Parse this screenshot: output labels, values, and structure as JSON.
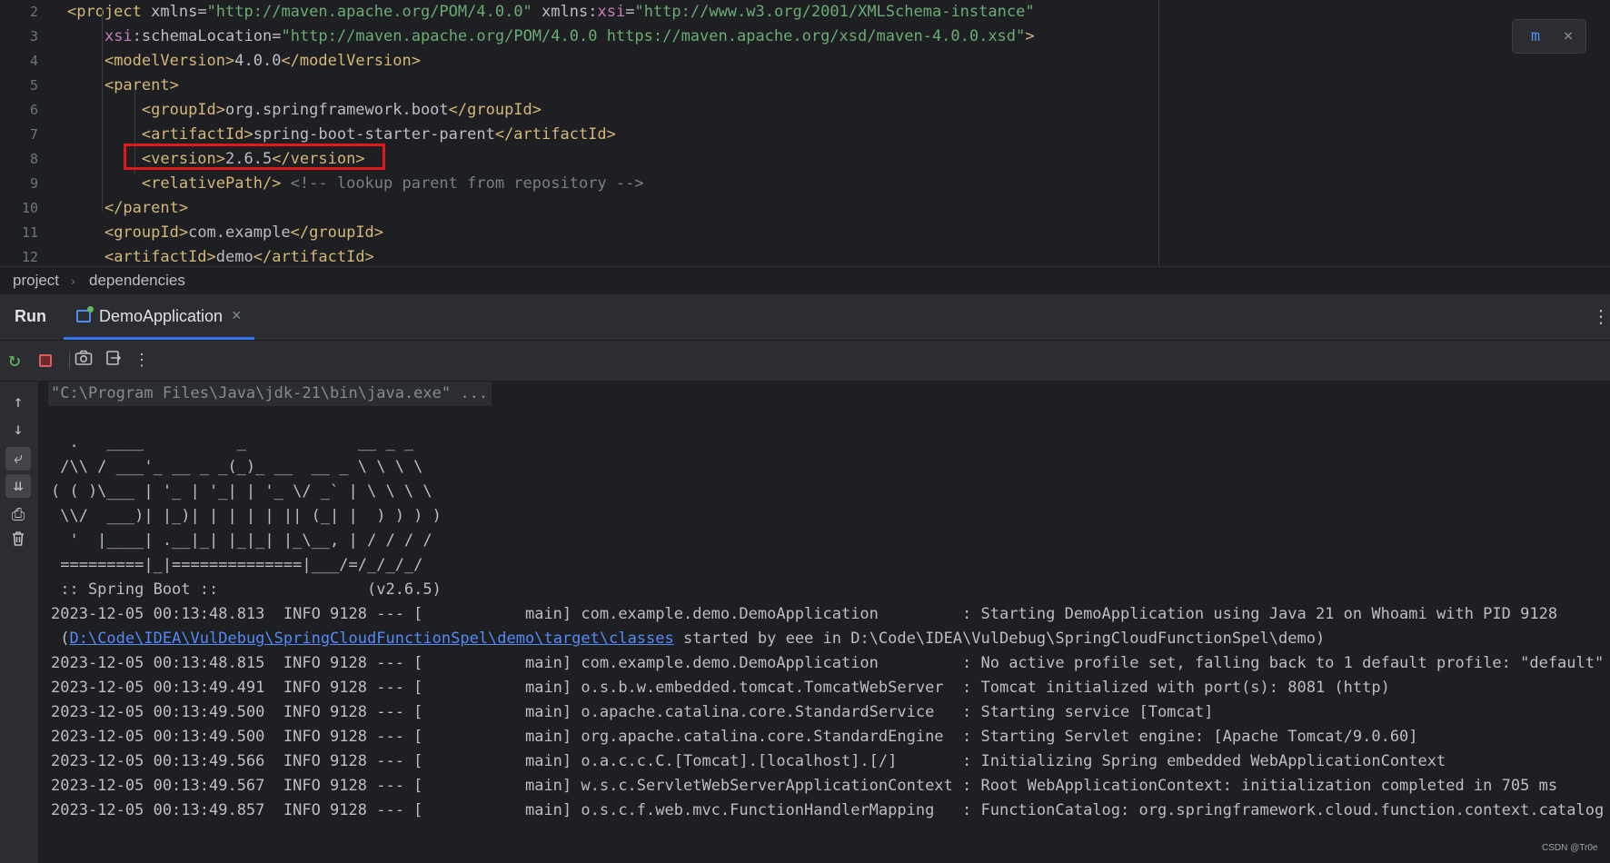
{
  "editor": {
    "line_numbers": [
      "2",
      "3",
      "4",
      "5",
      "6",
      "7",
      "8",
      "9",
      "10",
      "11",
      "12"
    ],
    "lines": [
      {
        "indent": "",
        "parts": [
          [
            "tag",
            "<project "
          ],
          [
            "attr",
            "xmlns"
          ],
          [
            "txt",
            "="
          ],
          [
            "str",
            "\"http://maven.apache.org/POM/4.0.0\""
          ],
          [
            "txt",
            " "
          ],
          [
            "attr",
            "xmlns"
          ],
          [
            "txt",
            ":"
          ],
          [
            "ns",
            "xsi"
          ],
          [
            "txt",
            "="
          ],
          [
            "str",
            "\"http://www.w3.org/2001/XMLSchema-instance\""
          ]
        ]
      },
      {
        "indent": "    ",
        "parts": [
          [
            "ns",
            "xsi"
          ],
          [
            "txt",
            ":"
          ],
          [
            "attr",
            "schemaLocation"
          ],
          [
            "txt",
            "="
          ],
          [
            "str",
            "\"http://maven.apache.org/POM/4.0.0 https://maven.apache.org/xsd/maven-4.0.0.xsd\""
          ],
          [
            "tag",
            ">"
          ]
        ]
      },
      {
        "indent": "    ",
        "parts": [
          [
            "tag",
            "<modelVersion>"
          ],
          [
            "txt",
            "4.0.0"
          ],
          [
            "tag",
            "</modelVersion>"
          ]
        ]
      },
      {
        "indent": "    ",
        "parts": [
          [
            "tag",
            "<parent>"
          ]
        ]
      },
      {
        "indent": "        ",
        "parts": [
          [
            "tag",
            "<groupId>"
          ],
          [
            "txt",
            "org.springframework.boot"
          ],
          [
            "tag",
            "</groupId>"
          ]
        ]
      },
      {
        "indent": "        ",
        "parts": [
          [
            "tag",
            "<artifactId>"
          ],
          [
            "txt",
            "spring-boot-starter-parent"
          ],
          [
            "tag",
            "</artifactId>"
          ]
        ]
      },
      {
        "indent": "        ",
        "parts": [
          [
            "tag",
            "<version>"
          ],
          [
            "txt",
            "2.6.5"
          ],
          [
            "tag",
            "</version>"
          ]
        ]
      },
      {
        "indent": "        ",
        "parts": [
          [
            "tag",
            "<relativePath/>"
          ],
          [
            "txt",
            " "
          ],
          [
            "cmt",
            "<!-- lookup parent from repository -->"
          ]
        ]
      },
      {
        "indent": "    ",
        "parts": [
          [
            "tag",
            "</parent>"
          ]
        ]
      },
      {
        "indent": "    ",
        "parts": [
          [
            "tag",
            "<groupId>"
          ],
          [
            "txt",
            "com.example"
          ],
          [
            "tag",
            "</groupId>"
          ]
        ]
      },
      {
        "indent": "    ",
        "parts": [
          [
            "tag",
            "<artifactId>"
          ],
          [
            "txt",
            "demo"
          ],
          [
            "tag",
            "</artifactId>"
          ]
        ]
      }
    ]
  },
  "breadcrumb": {
    "project": "project",
    "sep": "›",
    "child": "dependencies"
  },
  "run_panel": {
    "title": "Run",
    "tab_label": "DemoApplication",
    "tab_close": "×",
    "more": "⋮"
  },
  "toolbar": {
    "rerun": "↻",
    "camera": "📷",
    "exit": "⇥",
    "more": "⋮"
  },
  "rail": {
    "up": "↑",
    "down": "↓",
    "wrap": "⤶",
    "scroll_end": "⇊",
    "print": "⎙",
    "trash": "🗑"
  },
  "maven": {
    "refresh": "m",
    "close": "×"
  },
  "console": {
    "command": "\"C:\\Program Files\\Java\\jdk-21\\bin\\java.exe\" ...",
    "banner": [
      "  .   ____          _            __ _ _",
      " /\\\\ / ___'_ __ _ _(_)_ __  __ _ \\ \\ \\ \\",
      "( ( )\\___ | '_ | '_| | '_ \\/ _` | \\ \\ \\ \\",
      " \\\\/  ___)| |_)| | | | | || (_| |  ) ) ) )",
      "  '  |____| .__|_| |_|_| |_\\__, | / / / /",
      " =========|_|==============|___/=/_/_/_/",
      " :: Spring Boot ::                (v2.6.5)"
    ],
    "log_first": "2023-12-05 00:13:48.813  INFO 9128 --- [           main] com.example.demo.DemoApplication         : Starting DemoApplication using Java 21 on Whoami with PID 9128",
    "log_cont_prefix": " (",
    "log_cont_link": "D:\\Code\\IDEA\\VulDebug\\SpringCloudFunctionSpel\\demo\\target\\classes",
    "log_cont_suffix": " started by eee in D:\\Code\\IDEA\\VulDebug\\SpringCloudFunctionSpel\\demo)",
    "logs": [
      "2023-12-05 00:13:48.815  INFO 9128 --- [           main] com.example.demo.DemoApplication         : No active profile set, falling back to 1 default profile: \"default\"",
      "2023-12-05 00:13:49.491  INFO 9128 --- [           main] o.s.b.w.embedded.tomcat.TomcatWebServer  : Tomcat initialized with port(s): 8081 (http)",
      "2023-12-05 00:13:49.500  INFO 9128 --- [           main] o.apache.catalina.core.StandardService   : Starting service [Tomcat]",
      "2023-12-05 00:13:49.500  INFO 9128 --- [           main] org.apache.catalina.core.StandardEngine  : Starting Servlet engine: [Apache Tomcat/9.0.60]",
      "2023-12-05 00:13:49.566  INFO 9128 --- [           main] o.a.c.c.C.[Tomcat].[localhost].[/]       : Initializing Spring embedded WebApplicationContext",
      "2023-12-05 00:13:49.567  INFO 9128 --- [           main] w.s.c.ServletWebServerApplicationContext : Root WebApplicationContext: initialization completed in 705 ms",
      "2023-12-05 00:13:49.857  INFO 9128 --- [           main] o.s.c.f.web.mvc.FunctionHandlerMapping   : FunctionCatalog: org.springframework.cloud.function.context.catalog"
    ],
    "watermark": "CSDN @Tr0e"
  },
  "colors": {
    "accent": "#3574f0",
    "highlight_box": "#e0191d",
    "tag": "#d5b778",
    "string": "#6aab73",
    "link": "#548af7"
  }
}
